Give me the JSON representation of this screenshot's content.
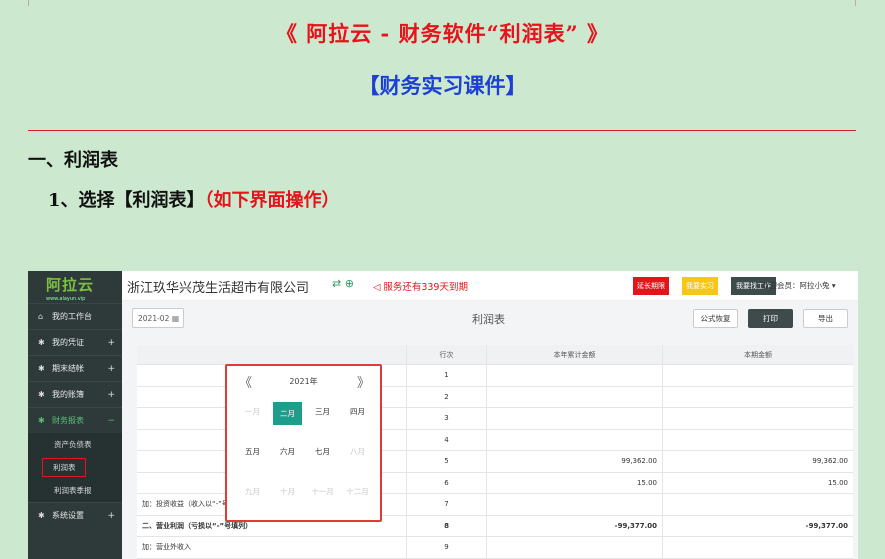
{
  "doc": {
    "title": "《 阿拉云 - 财务软件“利润表” 》",
    "subtitle": "【财务实习课件】",
    "heading1": "一、利润表",
    "heading2": "1、选择【利润表】",
    "heading2_note": "（如下界面操作）"
  },
  "app": {
    "logo_main": "阿拉云",
    "logo_sub": "www.alayun.vip",
    "company": "浙江玖华兴茂生活超市有限公司",
    "company_icons": "⇄ ⊕",
    "service_status": "◁ 服务还有339天到期",
    "top_buttons": [
      {
        "label": "延长期限",
        "color": "#e5141b"
      },
      {
        "label": "我要实习",
        "color": "#f6c716"
      },
      {
        "label": "我要找工作",
        "color": "#3d4b4b"
      }
    ],
    "welcome": "欢迎会员：阿拉小兔 ▾",
    "sidebar": {
      "items": [
        {
          "label": "我的工作台",
          "icon": "home-icon",
          "glyph": "⌂",
          "plus": ""
        },
        {
          "label": "我的凭证",
          "icon": "gear-icon",
          "glyph": "✱",
          "plus": "+"
        },
        {
          "label": "期末结帐",
          "icon": "gear-icon",
          "glyph": "✱",
          "plus": "+"
        },
        {
          "label": "我的账簿",
          "icon": "gear-icon",
          "glyph": "✱",
          "plus": "+"
        },
        {
          "label": "财务报表",
          "icon": "gear-icon",
          "glyph": "✱",
          "plus": "−"
        }
      ],
      "subitems": [
        "资产负债表",
        "利润表",
        "利润表季报"
      ],
      "bottom_item": {
        "label": "系统设置",
        "glyph": "✱",
        "plus": "+"
      }
    },
    "toolbar": {
      "date_value": "2021-02",
      "page_title": "利润表",
      "restore_label": "公式恢复",
      "print_label": "打印",
      "export_label": "导出"
    },
    "table": {
      "headers": [
        "",
        "行次",
        "本年累计金额",
        "本期金额"
      ],
      "rows": [
        {
          "name": "",
          "line": "1",
          "ytd": "",
          "period": "",
          "bold": false
        },
        {
          "name": "",
          "line": "2",
          "ytd": "",
          "period": "",
          "bold": false
        },
        {
          "name": "",
          "line": "3",
          "ytd": "",
          "period": "",
          "bold": false
        },
        {
          "name": "",
          "line": "4",
          "ytd": "",
          "period": "",
          "bold": false
        },
        {
          "name": "",
          "line": "5",
          "ytd": "99,362.00",
          "period": "99,362.00",
          "bold": false
        },
        {
          "name": "",
          "line": "6",
          "ytd": "15.00",
          "period": "15.00",
          "bold": false
        },
        {
          "name": "加：投资收益（收入以“-”号填列）",
          "line": "7",
          "ytd": "",
          "period": "",
          "bold": false
        },
        {
          "name": "二、营业利润（亏损以“-”号填列）",
          "line": "8",
          "ytd": "-99,377.00",
          "period": "-99,377.00",
          "bold": true
        },
        {
          "name": "加：营业外收入",
          "line": "9",
          "ytd": "",
          "period": "",
          "bold": false
        }
      ]
    },
    "picker": {
      "prev": "《",
      "year": "2021年",
      "next": "》",
      "months": [
        {
          "label": "一月",
          "state": "dis"
        },
        {
          "label": "二月",
          "state": "sel"
        },
        {
          "label": "三月",
          "state": ""
        },
        {
          "label": "四月",
          "state": ""
        },
        {
          "label": "五月",
          "state": ""
        },
        {
          "label": "六月",
          "state": ""
        },
        {
          "label": "七月",
          "state": ""
        },
        {
          "label": "八月",
          "state": "dis"
        },
        {
          "label": "九月",
          "state": "dis"
        },
        {
          "label": "十月",
          "state": "dis"
        },
        {
          "label": "十一月",
          "state": "dis"
        },
        {
          "label": "十二月",
          "state": "dis"
        }
      ]
    }
  }
}
